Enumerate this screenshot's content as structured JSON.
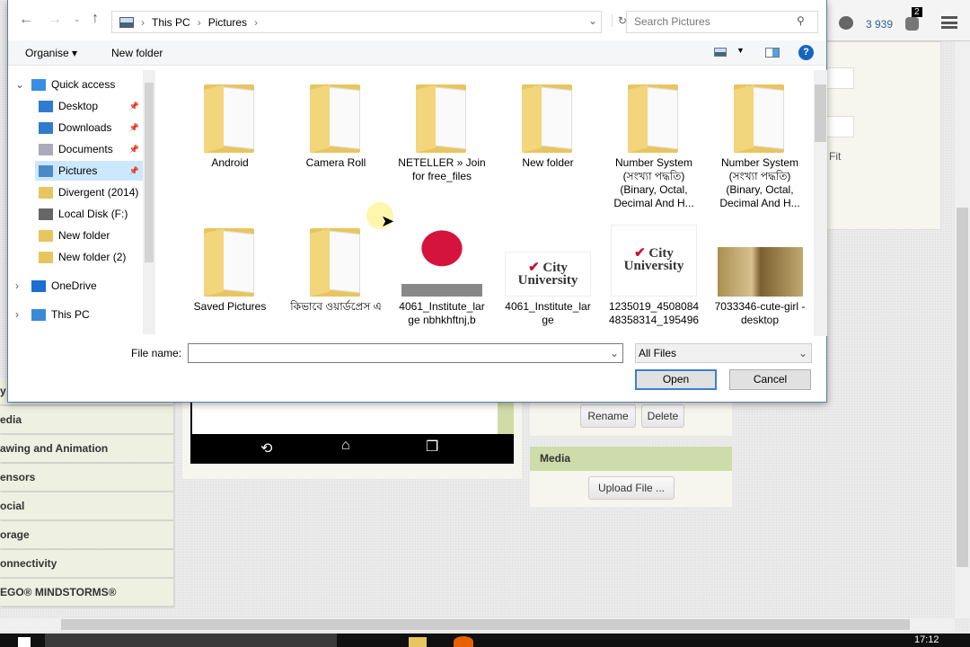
{
  "browser": {
    "notification_count": "3 939",
    "badge": "2",
    "fit_label": "Fit"
  },
  "app": {
    "palette": [
      "y",
      "edia",
      "awing and Animation",
      "ensors",
      "ocial",
      "orage",
      "onnectivity",
      "EGO® MINDSTORMS®"
    ],
    "rename": "Rename",
    "delete": "Delete",
    "media_header": "Media",
    "upload": "Upload File ..."
  },
  "dialog": {
    "breadcrumb": [
      "This PC",
      "Pictures"
    ],
    "search_placeholder": "Search Pictures",
    "organise": "Organise",
    "new_folder": "New folder",
    "nav": [
      {
        "label": "Quick access",
        "level": 0,
        "expand": "v"
      },
      {
        "label": "Desktop",
        "level": 1,
        "pinned": true
      },
      {
        "label": "Downloads",
        "level": 1,
        "pinned": true
      },
      {
        "label": "Documents",
        "level": 1,
        "pinned": true
      },
      {
        "label": "Pictures",
        "level": 1,
        "pinned": true,
        "selected": true
      },
      {
        "label": "Divergent (2014)",
        "level": 1
      },
      {
        "label": "Local Disk (F:)",
        "level": 1
      },
      {
        "label": "New folder",
        "level": 1
      },
      {
        "label": "New folder (2)",
        "level": 1
      },
      {
        "label": "OneDrive",
        "level": 0,
        "expand": ">"
      },
      {
        "label": "This PC",
        "level": 0,
        "expand": ">"
      }
    ],
    "files": [
      {
        "name": "Android",
        "type": "folder"
      },
      {
        "name": "Camera Roll",
        "type": "folder"
      },
      {
        "name": "NETELLER » Join for free_files",
        "type": "folder"
      },
      {
        "name": "New folder",
        "type": "folder"
      },
      {
        "name": "Number System (সংখ্যা পদ্ধতি) (Binary, Octal, Decimal And H...",
        "type": "folder"
      },
      {
        "name": "Number System (সংখ্যা পদ্ধতি) (Binary, Octal, Decimal And H...",
        "type": "folder"
      },
      {
        "name": "Saved Pictures",
        "type": "folder"
      },
      {
        "name": "কিভাবে ওয়ার্ডপ্রেস এ",
        "type": "folder"
      },
      {
        "name": "4061_Institute_lar ge nbhkhftnj,b",
        "type": "image"
      },
      {
        "name": "4061_Institute_lar ge",
        "type": "image",
        "logo": "City University"
      },
      {
        "name": "1235019_4508084 48358314_195496",
        "type": "image",
        "logo": "City University"
      },
      {
        "name": "7033346-cute-girl -desktop",
        "type": "image"
      }
    ],
    "file_name_label": "File name:",
    "file_name_value": "",
    "filter": "All Files",
    "open": "Open",
    "cancel": "Cancel"
  },
  "taskbar": {
    "time": "17:12"
  }
}
